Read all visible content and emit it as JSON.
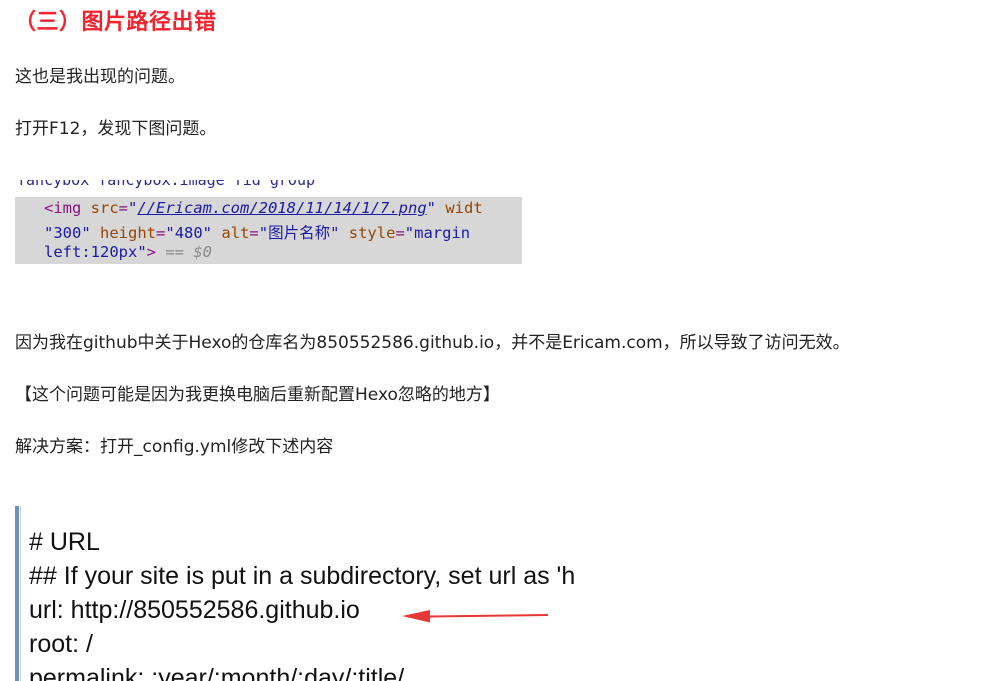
{
  "heading": "（三）图片路径出错",
  "paragraphs": {
    "p1": "这也是我出现的问题。",
    "p2": "打开F12，发现下图问题。",
    "p3": "因为我在github中关于Hexo的仓库名为850552586.github.io，并不是Ericam.com，所以导致了访问无效。",
    "p4": "【这个问题可能是因为我更换电脑后重新配置Hexo忽略的地方】",
    "p5": "解决方案：打开_config.yml修改下述内容"
  },
  "devtools": {
    "top_fragment": "fancybox fancybox:image fid group",
    "line1": {
      "open": "<img",
      "src_attr": "src",
      "src_val": "//Ericam.com/2018/11/14/1/7.png",
      "width_attr": "widt"
    },
    "line2": {
      "width_val": "\"300\"",
      "height_attr": "height",
      "height_val": "\"480\"",
      "alt_attr": "alt",
      "alt_val": "图片名称",
      "style_attr": "style",
      "style_val": "\"margin"
    },
    "line3": {
      "style_cont": "left:120px\"",
      "close": ">",
      "eq": "== $0"
    }
  },
  "config": {
    "lines": [
      "# URL",
      "## If your site is put in a subdirectory, set url as 'h",
      "url: http://850552586.github.io",
      "root: /",
      "permalink: :year/:month/:day/:title/"
    ]
  },
  "colors": {
    "heading": "#f5222d",
    "arrow": "#e53935"
  }
}
